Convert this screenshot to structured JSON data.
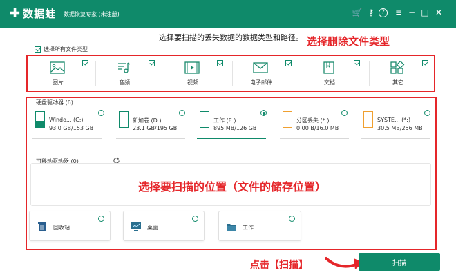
{
  "app": {
    "logo": "数据蛙",
    "subtitle": "数据恢复专家 (未注册)"
  },
  "window_controls": {
    "cart": "🛒",
    "key": "⚷",
    "help": "?",
    "menu": "≡",
    "minimize": "−",
    "maximize": "□",
    "close": "✕"
  },
  "prompt": "选择要扫描的丢失数据的数据类型和路径。",
  "annotations": {
    "file_types": "选择删除文件类型",
    "location": "选择要扫描的位置（文件的储存位置）",
    "click_scan": "点击【扫描】"
  },
  "select_all_label": "选择所有文件类型",
  "file_types": [
    {
      "label": "图片",
      "icon": "image-icon",
      "checked": true
    },
    {
      "label": "音频",
      "icon": "audio-icon",
      "checked": true
    },
    {
      "label": "视频",
      "icon": "video-icon",
      "checked": true
    },
    {
      "label": "电子邮件",
      "icon": "email-icon",
      "checked": true
    },
    {
      "label": "文档",
      "icon": "document-icon",
      "checked": true
    },
    {
      "label": "其它",
      "icon": "other-icon",
      "checked": true
    }
  ],
  "hard_drives": {
    "label": "硬盘驱动器 (6)",
    "items": [
      {
        "name": "Windo... (C:)",
        "size": "93.0 GB/153 GB",
        "selected": false
      },
      {
        "name": "新加卷 (D:)",
        "size": "23.1 GB/195 GB",
        "selected": false
      },
      {
        "name": "工作 (E:)",
        "size": "895 MB/126 GB",
        "selected": true
      },
      {
        "name": "分区丢失 (*:)",
        "size": "0.00  B/16.0 MB",
        "selected": false
      },
      {
        "name": "SYSTE... (*:)",
        "size": "30.5 MB/256 MB",
        "selected": false
      }
    ]
  },
  "removable": {
    "label": "可移动驱动器 (0)"
  },
  "locations": [
    {
      "label": "回收站",
      "icon": "recycle-bin-icon"
    },
    {
      "label": "桌面",
      "icon": "desktop-icon"
    },
    {
      "label": "工作",
      "icon": "folder-icon"
    }
  ],
  "scan_button": "扫描",
  "colors": {
    "brand": "#0f8a6a",
    "annotation": "#e5262a",
    "partition_lost": "#f0a030"
  }
}
